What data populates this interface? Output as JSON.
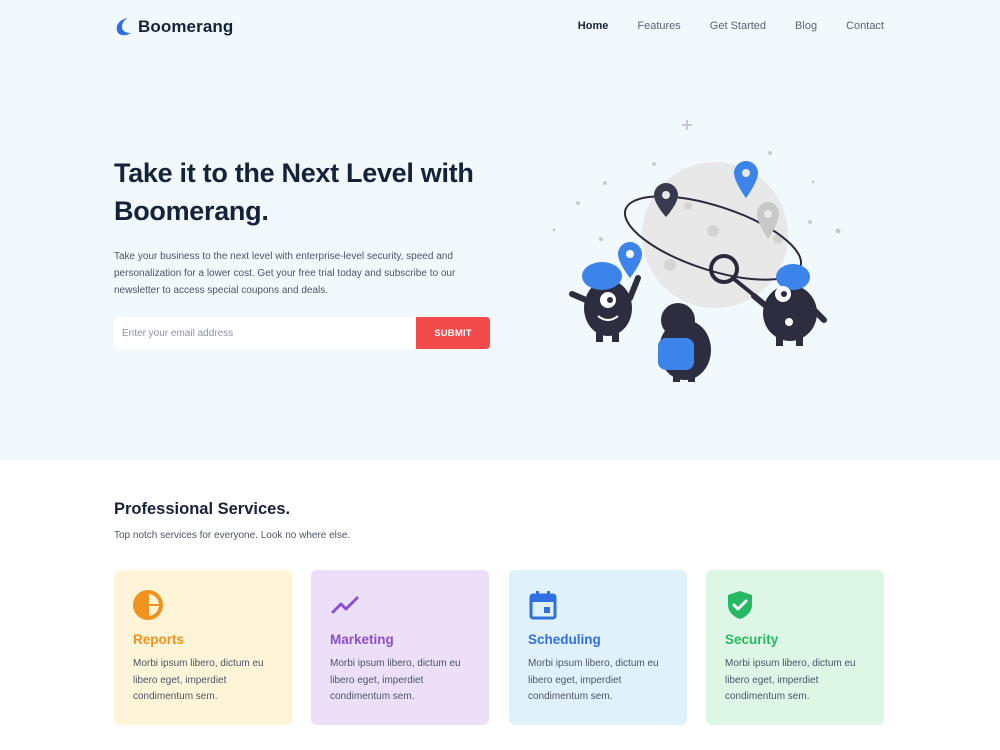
{
  "brand": {
    "name": "Boomerang",
    "logo_icon": "boomerang-logo-icon",
    "color": "#2f6fe0"
  },
  "nav": {
    "items": [
      {
        "label": "Home",
        "active": true
      },
      {
        "label": "Features",
        "active": false
      },
      {
        "label": "Get Started",
        "active": false
      },
      {
        "label": "Blog",
        "active": false
      },
      {
        "label": "Contact",
        "active": false
      }
    ]
  },
  "hero": {
    "title": "Take it to the Next Level with Boomerang.",
    "text": "Take your business to the next level with enterprise-level security, speed and personalization for a lower cost. Get your free trial today and subscribe to our newsletter to access special coupons and deals.",
    "email_placeholder": "Enter your email address",
    "email_value": "",
    "submit_label": "SUBMIT",
    "submit_color": "#f34b4b",
    "background": "#f2f9fd",
    "illustration_icon": "location-monsters-illustration"
  },
  "services": {
    "title": "Professional Services.",
    "subtitle": "Top notch services for everyone. Look no where else.",
    "cards": [
      {
        "title": "Reports",
        "text": "Morbi ipsum libero, dictum eu libero eget, imperdiet condimentum sem.",
        "icon": "pie-chart-icon",
        "accent": "#f0921e",
        "bg": "#fef5d9"
      },
      {
        "title": "Marketing",
        "text": "Morbi ipsum libero, dictum eu libero eget, imperdiet condimentum sem.",
        "icon": "trending-up-icon",
        "accent": "#8d4fd0",
        "bg": "#ecdff8"
      },
      {
        "title": "Scheduling",
        "text": "Morbi ipsum libero, dictum eu libero eget, imperdiet condimentum sem.",
        "icon": "calendar-icon",
        "accent": "#2f6fe0",
        "bg": "#dff2fb"
      },
      {
        "title": "Security",
        "text": "Morbi ipsum libero, dictum eu libero eget, imperdiet condimentum sem.",
        "icon": "shield-check-icon",
        "accent": "#25b964",
        "bg": "#ddf6e6"
      }
    ]
  }
}
